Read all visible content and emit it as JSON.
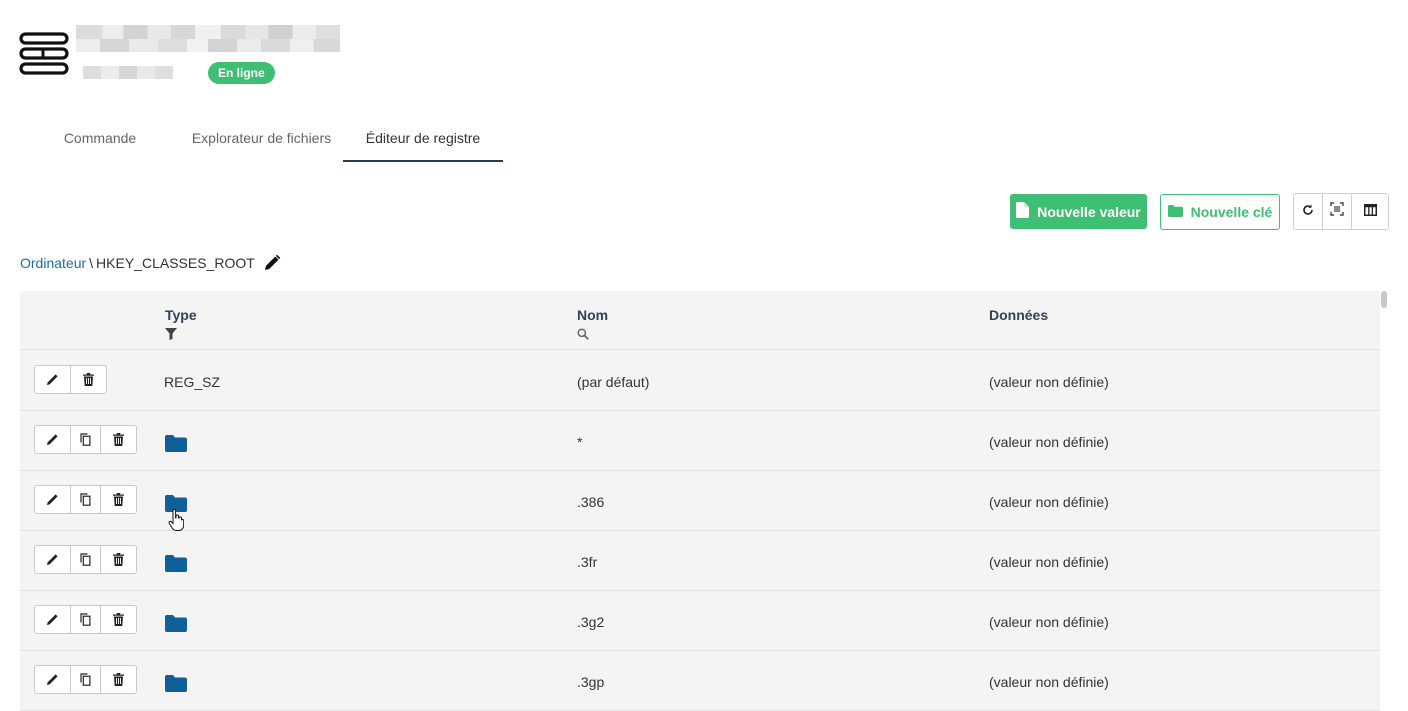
{
  "header": {
    "status": "En ligne"
  },
  "tabs": [
    {
      "label": "Commande"
    },
    {
      "label": "Explorateur de fichiers"
    },
    {
      "label": "Éditeur de registre"
    }
  ],
  "toolbar": {
    "new_value_label": "Nouvelle valeur",
    "new_key_label": "Nouvelle clé",
    "icons": [
      "refresh-icon",
      "fit-icon",
      "columns-icon"
    ]
  },
  "breadcrumb": {
    "root": "Ordinateur",
    "separator": "\\",
    "current": "HKEY_CLASSES_ROOT"
  },
  "table": {
    "columns": {
      "type": "Type",
      "nom": "Nom",
      "donnees": "Données"
    },
    "rows": [
      {
        "type": "REG_SZ",
        "is_key": false,
        "nom": "(par défaut)",
        "donnees": "(valeur non définie)"
      },
      {
        "type": "",
        "is_key": true,
        "nom": "*",
        "donnees": "(valeur non définie)"
      },
      {
        "type": "",
        "is_key": true,
        "nom": ".386",
        "donnees": "(valeur non définie)"
      },
      {
        "type": "",
        "is_key": true,
        "nom": ".3fr",
        "donnees": "(valeur non définie)"
      },
      {
        "type": "",
        "is_key": true,
        "nom": ".3g2",
        "donnees": "(valeur non définie)"
      },
      {
        "type": "",
        "is_key": true,
        "nom": ".3gp",
        "donnees": "(valeur non définie)"
      }
    ]
  },
  "colors": {
    "accent_green": "#3fbf74",
    "folder_blue": "#0f5f9a",
    "link_blue": "#1f6aa5",
    "tab_underline": "#2b3a55"
  }
}
